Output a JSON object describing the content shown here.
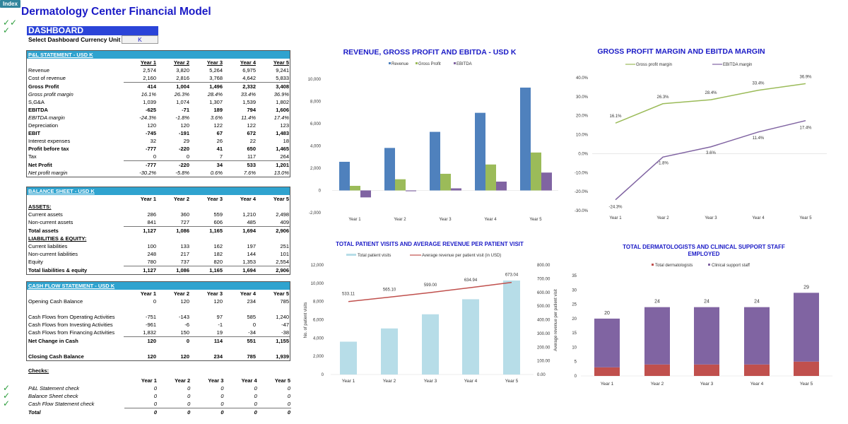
{
  "index_tab": "Index",
  "title": "Dermatology Center Financial Model",
  "dashboard": {
    "header": "DASHBOARD",
    "currency_label": "Select Dashboard Currency Unit",
    "currency_value": "K"
  },
  "years": [
    "Year 1",
    "Year 2",
    "Year 3",
    "Year 4",
    "Year 5"
  ],
  "pl": {
    "title": "P&L STATEMENT - USD K",
    "rows": [
      {
        "label": "Revenue",
        "values": [
          "2,574",
          "3,820",
          "5,264",
          "6,975",
          "9,241"
        ]
      },
      {
        "label": "Cost of revenue",
        "values": [
          "2,160",
          "2,816",
          "3,768",
          "4,642",
          "5,833"
        ]
      },
      {
        "label": "Gross Profit",
        "values": [
          "414",
          "1,004",
          "1,496",
          "2,332",
          "3,408"
        ]
      },
      {
        "label": "Gross profit margin",
        "values": [
          "16.1%",
          "26.3%",
          "28.4%",
          "33.4%",
          "36.9%"
        ]
      },
      {
        "label": "S,G&A",
        "values": [
          "1,039",
          "1,074",
          "1,307",
          "1,539",
          "1,802"
        ]
      },
      {
        "label": "EBITDA",
        "values": [
          "-625",
          "-71",
          "189",
          "794",
          "1,606"
        ]
      },
      {
        "label": "EBITDA margin",
        "values": [
          "-24.3%",
          "-1.8%",
          "3.6%",
          "11.4%",
          "17.4%"
        ]
      },
      {
        "label": "Depreciation",
        "values": [
          "120",
          "120",
          "122",
          "122",
          "123"
        ]
      },
      {
        "label": "EBIT",
        "values": [
          "-745",
          "-191",
          "67",
          "672",
          "1,483"
        ]
      },
      {
        "label": "Interest expenses",
        "values": [
          "32",
          "29",
          "26",
          "22",
          "18"
        ]
      },
      {
        "label": "Profit before tax",
        "values": [
          "-777",
          "-220",
          "41",
          "650",
          "1,465"
        ]
      },
      {
        "label": "Tax",
        "values": [
          "0",
          "0",
          "7",
          "117",
          "264"
        ]
      },
      {
        "label": "Net Profit",
        "values": [
          "-777",
          "-220",
          "34",
          "533",
          "1,201"
        ]
      },
      {
        "label": "Net profit margin",
        "values": [
          "-30.2%",
          "-5.8%",
          "0.6%",
          "7.6%",
          "13.0%"
        ]
      }
    ]
  },
  "bs": {
    "title": "BALANCE SHEET - USD K",
    "assets_label": "ASSETS:",
    "liab_label": "LIABILITIES & EQUITY:",
    "rows": [
      {
        "label": "Current assets",
        "values": [
          "286",
          "360",
          "559",
          "1,210",
          "2,498"
        ]
      },
      {
        "label": "Non-current assets",
        "values": [
          "841",
          "727",
          "606",
          "485",
          "409"
        ]
      },
      {
        "label": "Total assets",
        "values": [
          "1,127",
          "1,086",
          "1,165",
          "1,694",
          "2,906"
        ]
      },
      {
        "label": "Current liabilities",
        "values": [
          "100",
          "133",
          "162",
          "197",
          "251"
        ]
      },
      {
        "label": "Non-current liabilities",
        "values": [
          "248",
          "217",
          "182",
          "144",
          "101"
        ]
      },
      {
        "label": "Equity",
        "values": [
          "780",
          "737",
          "820",
          "1,353",
          "2,554"
        ]
      },
      {
        "label": "Total liabilities & equity",
        "values": [
          "1,127",
          "1,086",
          "1,165",
          "1,694",
          "2,906"
        ]
      }
    ]
  },
  "cf": {
    "title": "CASH FLOW STATEMENT -  USD K",
    "rows": [
      {
        "label": "Opening Cash Balance",
        "values": [
          "0",
          "120",
          "120",
          "234",
          "785"
        ]
      },
      {
        "label": "Cash Flows from Operating Activities",
        "values": [
          "-751",
          "-143",
          "97",
          "585",
          "1,240"
        ]
      },
      {
        "label": "Cash Flows from Investing Activities",
        "values": [
          "-961",
          "-6",
          "-1",
          "0",
          "-47"
        ]
      },
      {
        "label": "Cash Flows from Financing Activities",
        "values": [
          "1,832",
          "150",
          "19",
          "-34",
          "-38"
        ]
      },
      {
        "label": "Net Change in Cash",
        "values": [
          "120",
          "0",
          "114",
          "551",
          "1,155"
        ]
      },
      {
        "label": "Closing Cash Balance",
        "values": [
          "120",
          "120",
          "234",
          "785",
          "1,939"
        ]
      }
    ]
  },
  "checks": {
    "title": "Checks:",
    "rows": [
      {
        "label": "P&L Statement check",
        "values": [
          "0",
          "0",
          "0",
          "0",
          "0"
        ]
      },
      {
        "label": "Balance Sheet check",
        "values": [
          "0",
          "0",
          "0",
          "0",
          "0"
        ]
      },
      {
        "label": "Cash Flow Statement check",
        "values": [
          "0",
          "0",
          "0",
          "0",
          "0"
        ]
      },
      {
        "label": "Total",
        "values": [
          "0",
          "0",
          "0",
          "0",
          "0"
        ]
      }
    ]
  },
  "colors": {
    "revenue": "#4f81bd",
    "gross_profit": "#9bbb59",
    "ebitda": "#8064a2",
    "visits": "#b7dde8",
    "avg_rev": "#c0504d",
    "dermatologists": "#c0504d",
    "support": "#8064a2",
    "title_blue": "#1a1ac6"
  },
  "chart_data": [
    {
      "type": "bar",
      "title": "REVENUE, GROSS PROFIT AND EBITDA - USD K",
      "categories": [
        "Year 1",
        "Year 2",
        "Year 3",
        "Year 4",
        "Year 5"
      ],
      "series": [
        {
          "name": "Revenue",
          "values": [
            2574,
            3820,
            5264,
            6975,
            9241
          ]
        },
        {
          "name": "Gross Profit",
          "values": [
            414,
            1004,
            1496,
            2332,
            3408
          ]
        },
        {
          "name": "EBITDA",
          "values": [
            -625,
            -71,
            189,
            794,
            1606
          ]
        }
      ],
      "yticks": [
        "10,000",
        "8,000",
        "6,000",
        "4,000",
        "2,000",
        "0",
        "-2,000"
      ],
      "ylim": [
        -2000,
        10000
      ],
      "legend": "top"
    },
    {
      "type": "line",
      "title": "GROSS PROFIT MARGIN AND EBITDA MARGIN",
      "categories": [
        "Year 1",
        "Year 2",
        "Year 3",
        "Year 4",
        "Year 5"
      ],
      "series": [
        {
          "name": "Gross profit margin",
          "values": [
            16.1,
            26.3,
            28.4,
            33.4,
            36.9
          ],
          "labels": [
            "16.1%",
            "26.3%",
            "28.4%",
            "33.4%",
            "36.9%"
          ]
        },
        {
          "name": "EBITDA margin",
          "values": [
            -24.3,
            -1.8,
            3.6,
            11.4,
            17.4
          ],
          "labels": [
            "-24.3%",
            "-1.8%",
            "3.6%",
            "11.4%",
            "17.4%"
          ]
        }
      ],
      "yticks": [
        "40.0%",
        "30.0%",
        "20.0%",
        "10.0%",
        "0.0%",
        "-10.0%",
        "-20.0%",
        "-30.0%"
      ],
      "ylim": [
        -30,
        40
      ],
      "legend": "top"
    },
    {
      "type": "bar",
      "title": "TOTAL PATIENT VISITS AND AVERAGE REVENUE PER PATIENT VISIT",
      "categories": [
        "Year 1",
        "Year 2",
        "Year 3",
        "Year 4",
        "Year 5"
      ],
      "series": [
        {
          "name": "Total patient visits",
          "values": [
            3600,
            5050,
            6600,
            8250,
            10300
          ],
          "axis": "left"
        },
        {
          "name": "Average revenue per patient visit (in USD)",
          "values": [
            533.11,
            565.1,
            599.0,
            634.94,
            673.04
          ],
          "labels": [
            "533.11",
            "565.10",
            "599.00",
            "634.94",
            "673.04"
          ],
          "axis": "right",
          "type": "line"
        }
      ],
      "yticks": [
        "12,000",
        "10,000",
        "8,000",
        "6,000",
        "4,000",
        "2,000",
        "0"
      ],
      "y2ticks": [
        "800.00",
        "700.00",
        "600.00",
        "500.00",
        "400.00",
        "300.00",
        "200.00",
        "100.00",
        "0.00"
      ],
      "ylim": [
        0,
        12000
      ],
      "y2lim": [
        0,
        800
      ],
      "ylabel": "No. of  patient visits",
      "y2label": "Average  revenue per patient visit",
      "legend": "top"
    },
    {
      "type": "bar",
      "stacked": true,
      "title": "TOTAL DERMATOLOGISTS AND CLINICAL SUPPORT STAFF EMPLOYED",
      "categories": [
        "Year 1",
        "Year 2",
        "Year 3",
        "Year 4",
        "Year 5"
      ],
      "series": [
        {
          "name": "Total dermatologists",
          "values": [
            3,
            4,
            4,
            4,
            5
          ]
        },
        {
          "name": "Clinical support staff",
          "values": [
            17,
            20,
            20,
            20,
            24
          ]
        }
      ],
      "totals": [
        "20",
        "24",
        "24",
        "24",
        "29"
      ],
      "yticks": [
        "35",
        "30",
        "25",
        "20",
        "15",
        "10",
        "5",
        "0"
      ],
      "ylim": [
        0,
        35
      ],
      "legend": "top"
    }
  ]
}
